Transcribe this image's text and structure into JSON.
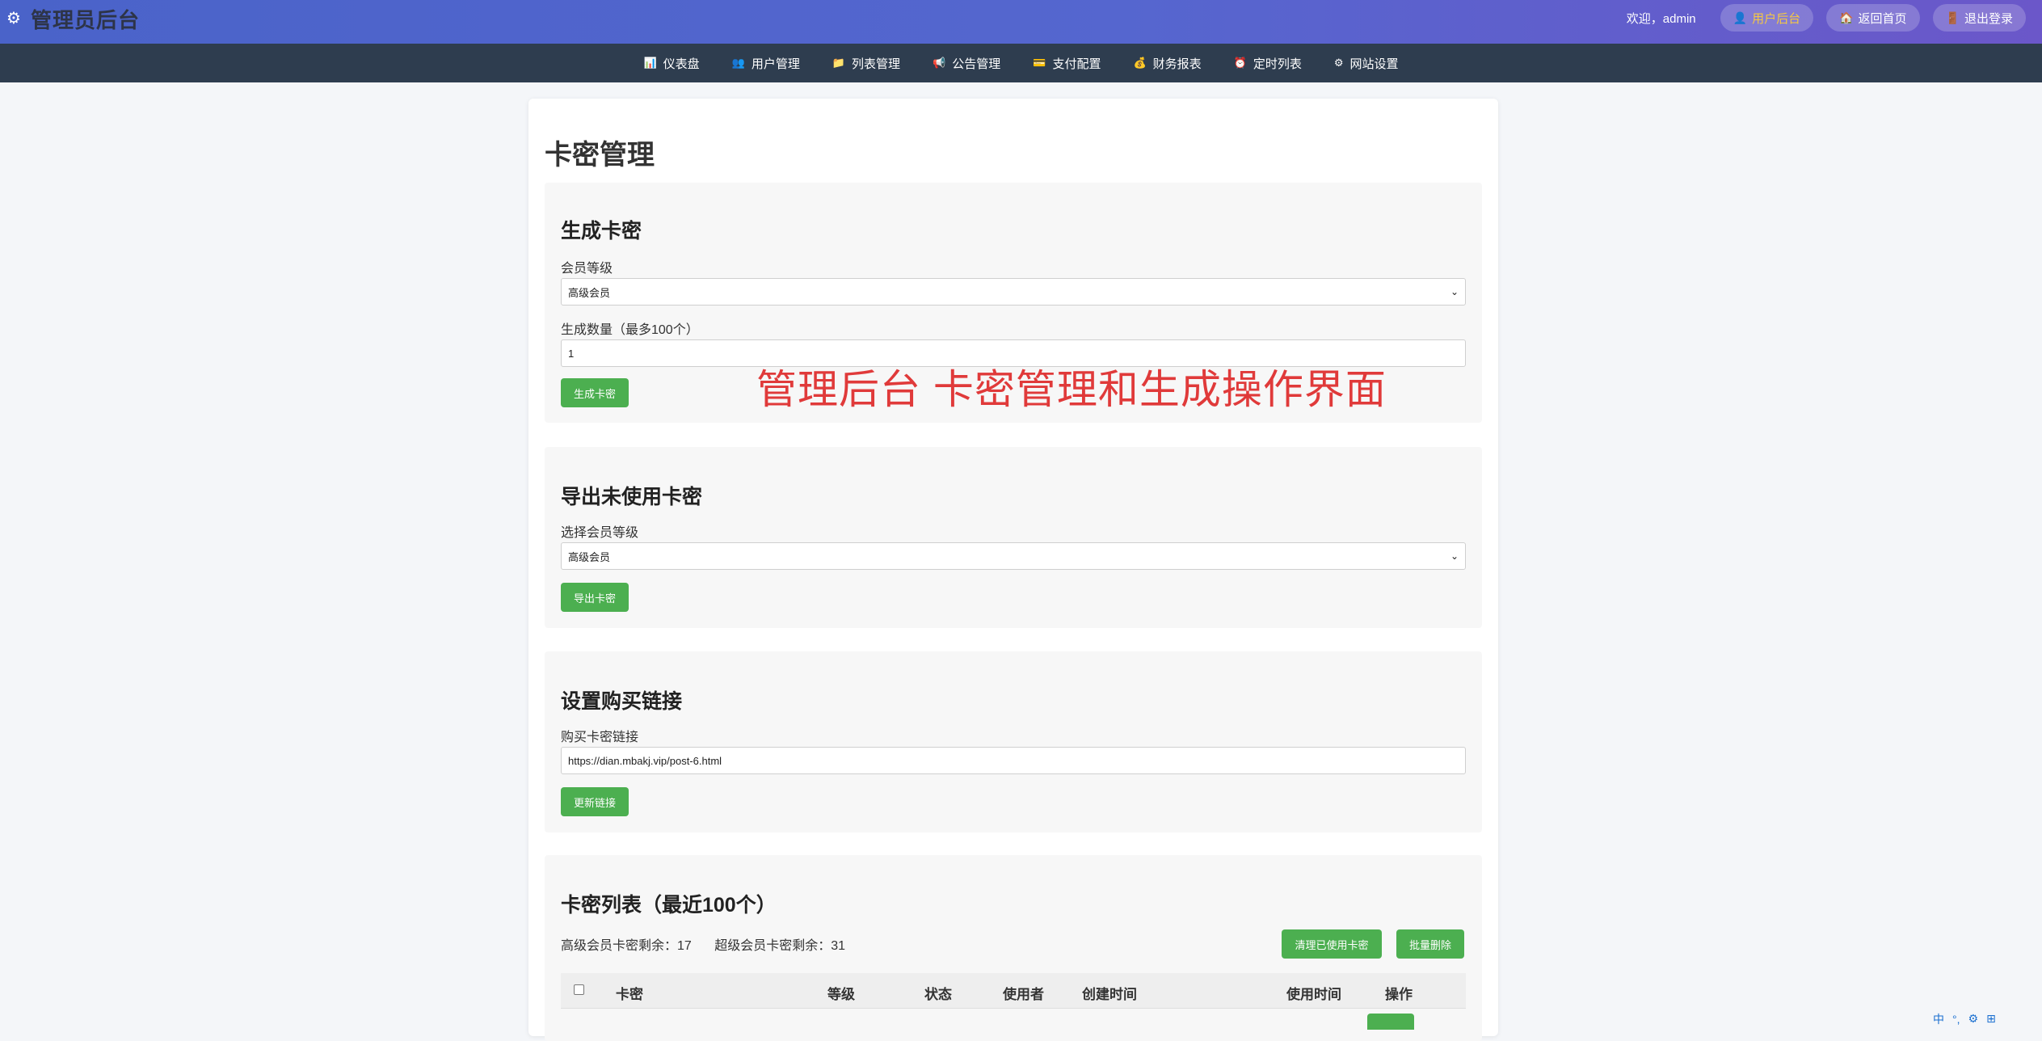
{
  "header": {
    "title": "管理员后台",
    "welcome": "欢迎，admin",
    "buttons": {
      "user_panel": "用户后台",
      "home": "返回首页",
      "logout": "退出登录"
    }
  },
  "nav": {
    "items": [
      "仪表盘",
      "用户管理",
      "列表管理",
      "公告管理",
      "支付配置",
      "财务报表",
      "定时列表",
      "网站设置"
    ]
  },
  "page": {
    "title": "卡密管理",
    "overlay": "管理后台  卡密管理和生成操作界面"
  },
  "generate": {
    "heading": "生成卡密",
    "level_label": "会员等级",
    "level_value": "高级会员",
    "qty_label": "生成数量（最多100个）",
    "qty_value": "1",
    "button": "生成卡密"
  },
  "export": {
    "heading": "导出未使用卡密",
    "level_label": "选择会员等级",
    "level_value": "高级会员",
    "button": "导出卡密"
  },
  "buylink": {
    "heading": "设置购买链接",
    "label": "购买卡密链接",
    "value": "https://dian.mbakj.vip/post-6.html",
    "button": "更新链接"
  },
  "list": {
    "heading": "卡密列表（最近100个）",
    "count_advanced": "高级会员卡密剩余：17",
    "count_super": "超级会员卡密剩余：31",
    "clear_button": "清理已使用卡密",
    "batch_delete_button": "批量删除",
    "columns": [
      "卡密",
      "等级",
      "状态",
      "使用者",
      "创建时间",
      "使用时间",
      "操作"
    ]
  },
  "ime": {
    "items": [
      "中",
      "°,",
      "⚙",
      "⊞"
    ]
  },
  "colors": {
    "header_start": "#4a63c9",
    "header_end": "#6b57c9",
    "nav_bg": "#2e3d4f",
    "accent_green": "#4caf50",
    "overlay_red": "#e03a3a"
  }
}
